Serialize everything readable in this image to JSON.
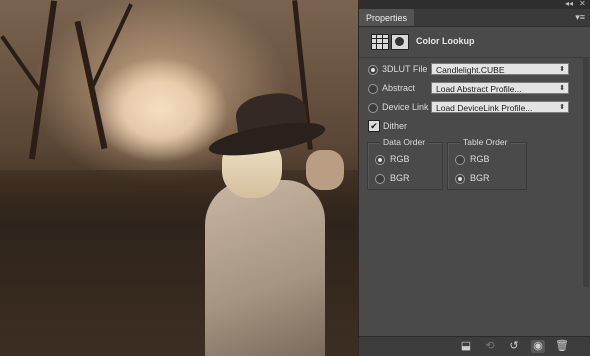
{
  "panel": {
    "tab_label": "Properties",
    "menu_icon": "panel-menu-icon",
    "collapse_icon": "collapse-arrows-icon",
    "close_icon": "close-icon",
    "title": "Color Lookup",
    "radios": [
      {
        "label": "3DLUT File",
        "selected": true,
        "value": "Candlelight.CUBE"
      },
      {
        "label": "Abstract",
        "selected": false,
        "value": "Load Abstract Profile..."
      },
      {
        "label": "Device Link",
        "selected": false,
        "value": "Load DeviceLink Profile..."
      }
    ],
    "dither": {
      "label": "Dither",
      "checked": true
    },
    "data_order": {
      "title": "Data Order",
      "options": [
        "RGB",
        "BGR"
      ],
      "selected": "RGB"
    },
    "table_order": {
      "title": "Table Order",
      "options": [
        "RGB",
        "BGR"
      ],
      "selected": "BGR"
    }
  },
  "bottom_icons": [
    "clip-to-layer-icon",
    "view-previous-icon",
    "reset-icon",
    "visibility-icon",
    "trash-icon"
  ]
}
